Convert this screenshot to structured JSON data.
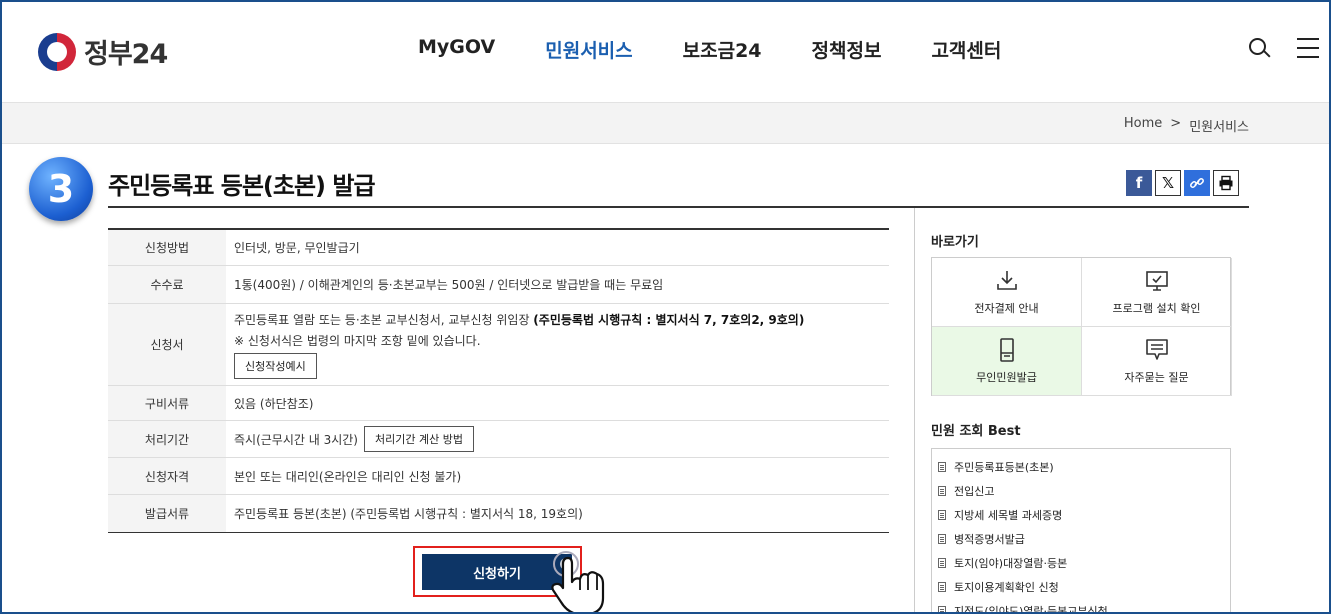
{
  "header": {
    "logo_text": "정부24",
    "nav": [
      "MyGOV",
      "민원서비스",
      "보조금24",
      "정책정보",
      "고객센터"
    ],
    "active_nav_index": 1,
    "search_icon": "search-icon",
    "menu_icon": "hamburger-menu-icon"
  },
  "breadcrumb": {
    "home": "Home",
    "separator": ">",
    "current": "민원서비스"
  },
  "step_number": "3",
  "page_title": "주민등록표 등본(초본) 발급",
  "share_icons": [
    "facebook-icon",
    "x-icon",
    "link-icon",
    "print-icon"
  ],
  "table": {
    "rows": [
      {
        "label": "신청방법",
        "value": "인터넷, 방문, 무인발급기"
      },
      {
        "label": "수수료",
        "value": "1통(400원) / 이해관계인의 등·초본교부는 500원 / 인터넷으로 발급받을 때는 무료임"
      },
      {
        "label": "신청서",
        "value_prefix": "주민등록표 열람 또는 등·초본 교부신청서, 교부신청 위임장 ",
        "value_bold": "(주민등록법 시행규칙 : 별지서식 7, 7호의2, 9호의)",
        "note": "※ 신청서식은 법령의 마지막 조항 밑에 있습니다.",
        "button": "신청작성예시"
      },
      {
        "label": "구비서류",
        "value": "있음 (하단참조)"
      },
      {
        "label": "처리기간",
        "value": "즉시(근무시간 내 3시간)",
        "button": "처리기간 계산 방법"
      },
      {
        "label": "신청자격",
        "value": "본인 또는 대리인(온라인은 대리인 신청 불가)"
      },
      {
        "label": "발급서류",
        "value": "주민등록표 등본(초본) (주민등록법 시행규칙 : 별지서식 18, 19호의)"
      }
    ]
  },
  "apply_button": "신청하기",
  "sidebar": {
    "quick_title": "바로가기",
    "quick_links": [
      {
        "label": "전자결제 안내",
        "icon": "download-icon"
      },
      {
        "label": "프로그램 설치 확인",
        "icon": "monitor-check-icon"
      },
      {
        "label": "무인민원발급",
        "icon": "kiosk-icon"
      },
      {
        "label": "자주묻는 질문",
        "icon": "chat-icon"
      }
    ],
    "best_title": "민원 조회 Best",
    "best_list": [
      "주민등록표등본(초본)",
      "전입신고",
      "지방세 세목별 과세증명",
      "병적증명서발급",
      "토지(임야)대장열람·등본",
      "토지이용계획확인 신청",
      "지적도(임야도)열람·등본교부신청"
    ]
  },
  "colors": {
    "accent": "#1b5fb0",
    "apply_bg": "#0d3566",
    "highlight_border": "#e2201c",
    "step_badge": "#1c5fd1"
  }
}
